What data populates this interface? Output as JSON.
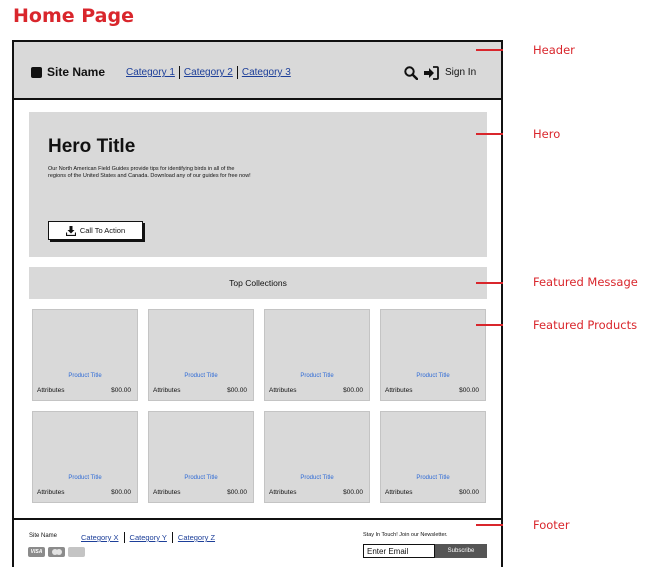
{
  "page_title": "Home Page",
  "header": {
    "site_name": "Site Name",
    "nav": [
      "Category 1",
      "Category 2",
      "Category 3"
    ],
    "sign_in": "Sign In"
  },
  "hero": {
    "title": "Hero Title",
    "text": "Our North American Field Guides provide tips for identifying birds in all of the regions of the United States and Canada. Download any of our guides for free now!",
    "cta": "Call To Action"
  },
  "featured_message": "Top Collections",
  "products": [
    {
      "title": "Product Title",
      "attributes": "Attributes",
      "price": "$00.00"
    },
    {
      "title": "Product Title",
      "attributes": "Attributes",
      "price": "$00.00"
    },
    {
      "title": "Product Title",
      "attributes": "Attributes",
      "price": "$00.00"
    },
    {
      "title": "Product Title",
      "attributes": "Attributes",
      "price": "$00.00"
    },
    {
      "title": "Product Title",
      "attributes": "Attributes",
      "price": "$00.00"
    },
    {
      "title": "Product Title",
      "attributes": "Attributes",
      "price": "$00.00"
    },
    {
      "title": "Product Title",
      "attributes": "Attributes",
      "price": "$00.00"
    },
    {
      "title": "Product Title",
      "attributes": "Attributes",
      "price": "$00.00"
    }
  ],
  "footer": {
    "site_name": "Site Name",
    "nav": [
      "Category X",
      "Category Y",
      "Category Z"
    ],
    "newsletter": "Stay In Touch! Join our Newsletter.",
    "email_placeholder": "Enter Email",
    "subscribe": "Subscribe",
    "payment_icons": [
      "visa-icon",
      "mastercard-icon",
      "amex-icon"
    ],
    "visa_text": "VISA"
  },
  "annotations": {
    "header": "Header",
    "hero": "Hero",
    "featured_message": "Featured Message",
    "featured_products": "Featured Products",
    "footer": "Footer"
  },
  "colors": {
    "accent": "#d9262c",
    "panel": "#d9d9d9",
    "link": "#1d3f99",
    "product_title": "#2f6bd6"
  }
}
